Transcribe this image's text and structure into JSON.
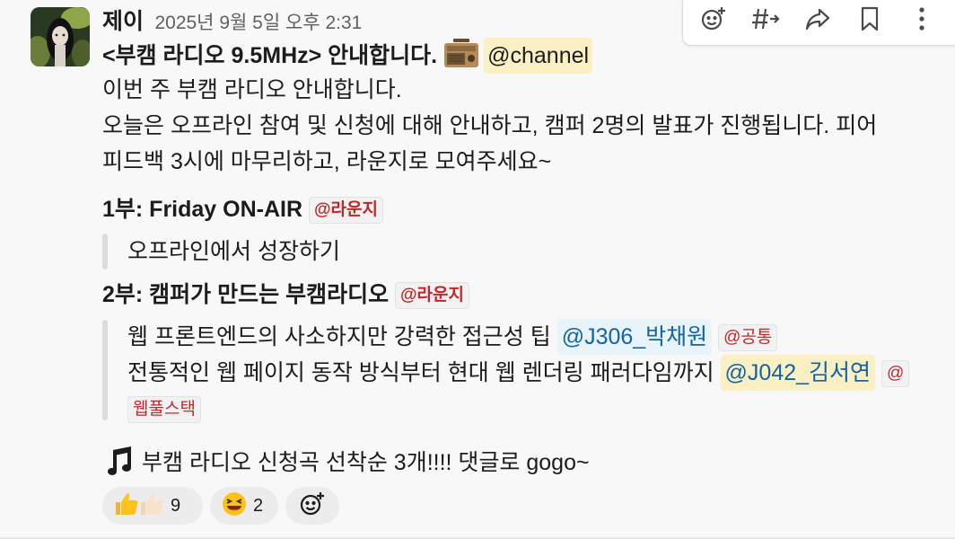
{
  "message": {
    "author": "제이",
    "timestamp": "2025년 9월 5일 오후 2:31",
    "title": "<부캠 라디오 9.5MHz> 안내합니다.",
    "channel_mention": "@channel",
    "body_lines": [
      "이번 주 부캠 라디오 안내합니다.",
      "오늘은 오프라인 참여 및 신청에 대해 안내하고, 캠퍼 2명의 발표가 진행됩니다. 피어",
      "피드백 3시에 마무리하고, 라운지로 모여주세요~"
    ],
    "sections": [
      {
        "heading": "1부: Friday ON-AIR",
        "tag": "@라운지",
        "items": [
          {
            "text": "오프라인에서 성장하기"
          }
        ]
      },
      {
        "heading": "2부: 캠퍼가 만드는 부캠라디오",
        "tag": "@라운지",
        "items": [
          {
            "text": "웹 프론트엔드의 사소하지만 강력한 접근성 팁",
            "mention": "@J306_박채원",
            "tag": "@공통"
          },
          {
            "text": "전통적인 웹 페이지 동작 방식부터 현대 웹 렌더링 패러다임까지",
            "mention": "@J042_김서연",
            "tag": "@",
            "tag_wrap": "웹풀스택"
          }
        ]
      }
    ],
    "closing": "부캠 라디오 신청곡 선착순 3개!!!! 댓글로 gogo~"
  },
  "reactions": [
    {
      "emoji": "thumbs-up",
      "count": "9"
    },
    {
      "emoji": "laughing-face",
      "count": "2"
    }
  ],
  "toolbar": {
    "actions": [
      "add-reaction-icon",
      "channel-forward-icon",
      "share-icon",
      "bookmark-icon",
      "more-icon"
    ]
  },
  "colors": {
    "mention_user_bg": "#e8f3fa",
    "mention_user_text": "#1264a3",
    "mention_channel_bg": "#fbefc4",
    "tag_text": "#c1282d"
  }
}
